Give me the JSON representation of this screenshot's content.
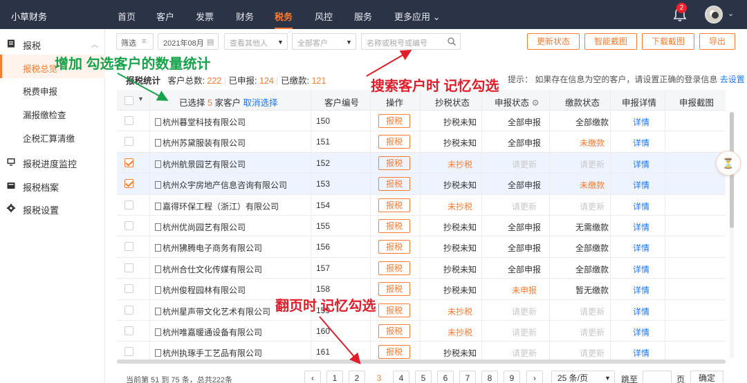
{
  "brand": "小草财务",
  "nav": [
    "首页",
    "客户",
    "发票",
    "财务",
    "税务",
    "风控",
    "服务",
    "更多应用"
  ],
  "notification_count": "2",
  "sidebar": {
    "groups": [
      {
        "label": "报税",
        "items": [
          "报税总览",
          "税费申报",
          "漏报缴检查",
          "企税汇算清缴"
        ]
      },
      {
        "label": "报税进度监控",
        "items": []
      },
      {
        "label": "报税档案",
        "items": []
      },
      {
        "label": "报税设置",
        "items": []
      }
    ]
  },
  "filters": {
    "filter_label": "筛选",
    "period": "2021年08月",
    "other_person_placeholder": "查看其他人",
    "customer_select": "全部客户",
    "search_placeholder": "名称或税号或编号"
  },
  "actions": [
    "更新状态",
    "智能截图",
    "下载截图",
    "导出"
  ],
  "stats": {
    "title": "报税统计",
    "total_label": "客户总数:",
    "total": "222",
    "declared_label": "已申报:",
    "declared": "124",
    "paid_label": "已缴款:",
    "paid": "121",
    "tip_prefix": "提示：",
    "tip": "如果存在信息为空的客户，请设置正确的登录信息",
    "tip_link": "去设置"
  },
  "table": {
    "selected_prefix": "已选择",
    "selected_count": "5",
    "selected_suffix": "家客户",
    "cancel_label": "取消选择",
    "columns": [
      "客户编号",
      "操作",
      "抄税状态",
      "申报状态",
      "缴款状态",
      "申报详情",
      "申报截图"
    ],
    "action_label": "报税",
    "detail_label": "详情",
    "rows": [
      {
        "name": "杭州暮堂科技有限公司",
        "id": "150",
        "copy": "抄税未知",
        "declare": "全部申报",
        "pay": "全部缴款",
        "checked": false
      },
      {
        "name": "杭州苏黛服装有限公司",
        "id": "151",
        "copy": "抄税未知",
        "declare": "全部申报",
        "pay": "未缴款",
        "checked": false
      },
      {
        "name": "杭州航景园艺有限公司",
        "id": "152",
        "copy": "未抄税",
        "declare": "请更新",
        "pay": "请更新",
        "checked": true
      },
      {
        "name": "杭州众宇房地产信息咨询有限公司",
        "id": "153",
        "copy": "抄税未知",
        "declare": "全部申报",
        "pay": "未缴款",
        "checked": true
      },
      {
        "name": "嘉得环保工程（浙江）有限公司",
        "id": "154",
        "copy": "未抄税",
        "declare": "请更新",
        "pay": "请更新",
        "checked": false
      },
      {
        "name": "杭州优尚园艺有限公司",
        "id": "155",
        "copy": "抄税未知",
        "declare": "全部申报",
        "pay": "无需缴款",
        "checked": false
      },
      {
        "name": "杭州狒腾电子商务有限公司",
        "id": "156",
        "copy": "抄税未知",
        "declare": "全部申报",
        "pay": "全部缴款",
        "checked": false
      },
      {
        "name": "杭州合仕文化传媒有限公司",
        "id": "157",
        "copy": "抄税未知",
        "declare": "全部申报",
        "pay": "全部缴款",
        "checked": false
      },
      {
        "name": "杭州俊程园林有限公司",
        "id": "158",
        "copy": "抄税未知",
        "declare": "未申报",
        "pay": "暂无缴款",
        "checked": false
      },
      {
        "name": "杭州星声带文化艺术有限公司",
        "id": "159",
        "copy": "未抄税",
        "declare": "请更新",
        "pay": "请更新",
        "checked": false
      },
      {
        "name": "杭州唯嘉暖通设备有限公司",
        "id": "160",
        "copy": "未抄税",
        "declare": "请更新",
        "pay": "请更新",
        "checked": false
      },
      {
        "name": "杭州执琢手工艺品有限公司",
        "id": "161",
        "copy": "抄税未知",
        "declare": "请更新",
        "pay": "请更新",
        "checked": false
      }
    ]
  },
  "pagination": {
    "summary": "当前第 51 到 75 条，总共222条",
    "pages": [
      "1",
      "2",
      "3",
      "4",
      "5",
      "6",
      "7",
      "8",
      "9"
    ],
    "current": "3",
    "page_size": "25 条/页",
    "jump_label": "跳至",
    "page_suffix": "页",
    "confirm": "确定"
  },
  "annotations": {
    "left": "增加 勾选客户的数量统计",
    "top": "搜索客户时 记忆勾选",
    "bottom": "翻页时 记忆勾选"
  },
  "colors": {
    "accent": "#ff7a2f",
    "nav_bg": "#2b3347",
    "link": "#1677ff",
    "annotation_green": "#16a34a",
    "annotation_red": "#e11d2a"
  }
}
